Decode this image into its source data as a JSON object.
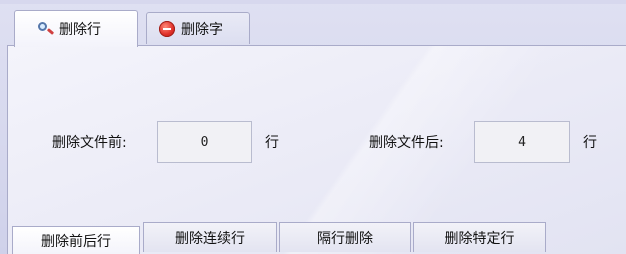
{
  "tabs": [
    {
      "label": "删除行",
      "icon": "search-icon",
      "active": true
    },
    {
      "label": "删除字",
      "icon": "remove-icon",
      "active": false
    }
  ],
  "fields": {
    "before": {
      "label": "删除文件前:",
      "value": "0",
      "unit": "行"
    },
    "after": {
      "label": "删除文件后:",
      "value": "4",
      "unit": "行"
    }
  },
  "bottom_tabs": [
    "删除前后行",
    "删除连续行",
    "隔行删除",
    "删除特定行"
  ],
  "colors": {
    "border": "#a9abc9",
    "remove_icon": "#e0302a"
  }
}
